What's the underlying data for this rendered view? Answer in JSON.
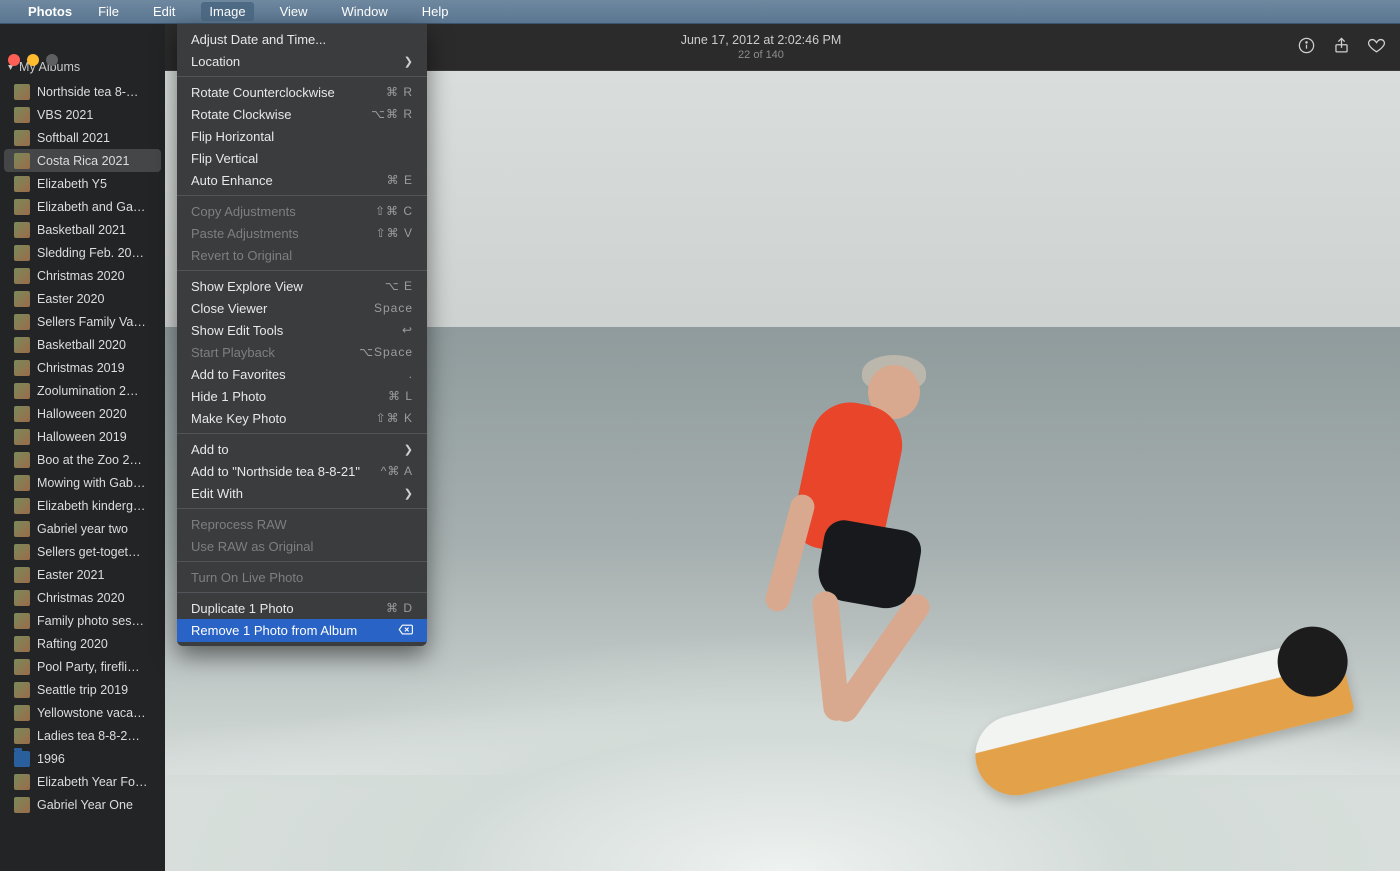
{
  "menubar": {
    "app": "Photos",
    "items": [
      "File",
      "Edit",
      "Image",
      "View",
      "Window",
      "Help"
    ],
    "active": "Image"
  },
  "sidebar": {
    "header": "My Albums",
    "selected_index": 3,
    "albums": [
      {
        "label": "Northside tea 8-…"
      },
      {
        "label": "VBS 2021"
      },
      {
        "label": "Softball 2021"
      },
      {
        "label": "Costa Rica 2021"
      },
      {
        "label": "Elizabeth Y5"
      },
      {
        "label": "Elizabeth and Ga…"
      },
      {
        "label": "Basketball 2021"
      },
      {
        "label": "Sledding Feb. 20…"
      },
      {
        "label": "Christmas 2020"
      },
      {
        "label": "Easter 2020"
      },
      {
        "label": "Sellers Family Va…"
      },
      {
        "label": "Basketball 2020"
      },
      {
        "label": "Christmas 2019"
      },
      {
        "label": "Zoolumination 2…"
      },
      {
        "label": "Halloween 2020"
      },
      {
        "label": "Halloween 2019"
      },
      {
        "label": "Boo at the Zoo 2…"
      },
      {
        "label": "Mowing with Gab…"
      },
      {
        "label": "Elizabeth kinderg…"
      },
      {
        "label": "Gabriel year two"
      },
      {
        "label": "Sellers get-toget…"
      },
      {
        "label": "Easter 2021"
      },
      {
        "label": "Christmas 2020"
      },
      {
        "label": "Family photo ses…"
      },
      {
        "label": "Rafting 2020"
      },
      {
        "label": "Pool Party, firefli…"
      },
      {
        "label": "Seattle trip 2019"
      },
      {
        "label": "Yellowstone vaca…"
      },
      {
        "label": "Ladies tea 8-8-2…"
      },
      {
        "label": "1996",
        "folder": true
      },
      {
        "label": "Elizabeth Year Fo…"
      },
      {
        "label": "Gabriel Year One"
      }
    ]
  },
  "toolbar": {
    "date": "June 17, 2012 at 2:02:46 PM",
    "counter": "22 of 140"
  },
  "dropdown": {
    "sections": [
      [
        {
          "label": "Adjust Date and Time...",
          "shortcut": "",
          "submenu": false
        },
        {
          "label": "Location",
          "shortcut": "",
          "submenu": true
        }
      ],
      [
        {
          "label": "Rotate Counterclockwise",
          "shortcut": "⌘ R"
        },
        {
          "label": "Rotate Clockwise",
          "shortcut": "⌥⌘ R"
        },
        {
          "label": "Flip Horizontal",
          "shortcut": ""
        },
        {
          "label": "Flip Vertical",
          "shortcut": ""
        },
        {
          "label": "Auto Enhance",
          "shortcut": "⌘ E"
        }
      ],
      [
        {
          "label": "Copy Adjustments",
          "shortcut": "⇧⌘ C",
          "disabled": true
        },
        {
          "label": "Paste Adjustments",
          "shortcut": "⇧⌘ V",
          "disabled": true
        },
        {
          "label": "Revert to Original",
          "shortcut": "",
          "disabled": true
        }
      ],
      [
        {
          "label": "Show Explore View",
          "shortcut": "⌥ E"
        },
        {
          "label": "Close Viewer",
          "shortcut": "Space"
        },
        {
          "label": "Show Edit Tools",
          "shortcut": "↩"
        },
        {
          "label": "Start Playback",
          "shortcut": "⌥Space",
          "disabled": true
        },
        {
          "label": "Add to Favorites",
          "shortcut": "."
        },
        {
          "label": "Hide 1 Photo",
          "shortcut": "⌘ L"
        },
        {
          "label": "Make Key Photo",
          "shortcut": "⇧⌘ K"
        }
      ],
      [
        {
          "label": "Add to",
          "shortcut": "",
          "submenu": true
        },
        {
          "label": "Add to \"Northside tea 8-8-21\"",
          "shortcut": "^⌘ A"
        },
        {
          "label": "Edit With",
          "shortcut": "",
          "submenu": true
        }
      ],
      [
        {
          "label": "Reprocess RAW",
          "shortcut": "",
          "disabled": true
        },
        {
          "label": "Use RAW as Original",
          "shortcut": "",
          "disabled": true
        }
      ],
      [
        {
          "label": "Turn On Live Photo",
          "shortcut": "",
          "disabled": true
        }
      ],
      [
        {
          "label": "Duplicate 1 Photo",
          "shortcut": "⌘ D"
        },
        {
          "label": "Remove 1 Photo from Album",
          "shortcut": "",
          "highlight": true,
          "deleteIcon": true
        }
      ]
    ]
  }
}
